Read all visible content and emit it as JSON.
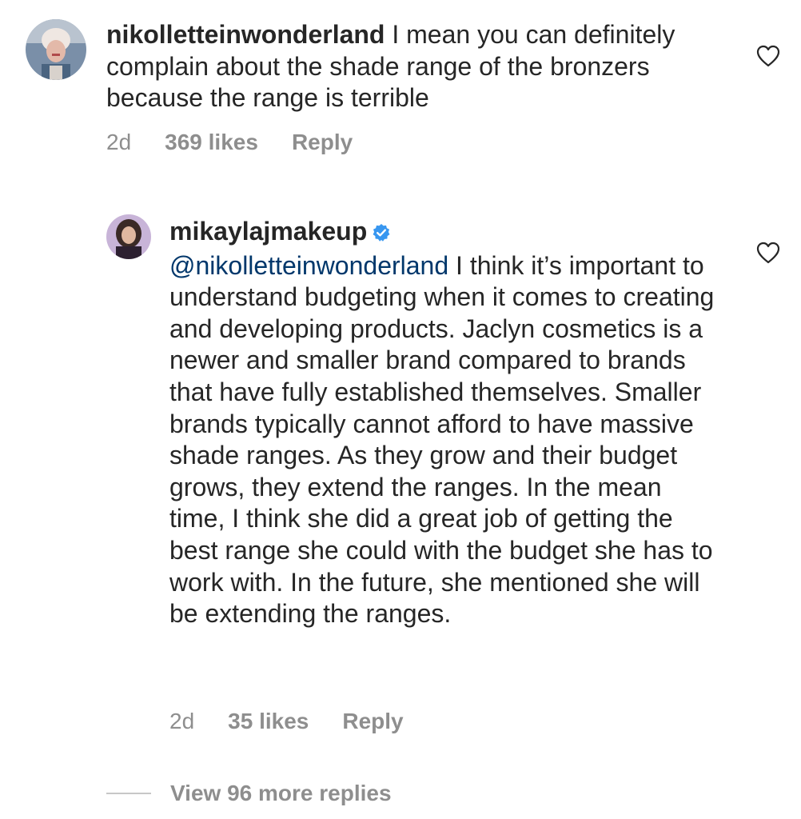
{
  "comments": [
    {
      "username": "nikolletteinwonderland",
      "text": "I mean you can definitely complain about the shade range of the bronzers because the range is terrible",
      "time": "2d",
      "likes": "369 likes",
      "reply_label": "Reply",
      "avatar_icon": "user-avatar"
    },
    {
      "username": "mikaylajmakeup",
      "verified": true,
      "mention": "@nikolletteinwonderland",
      "text": "I think it’s important to understand budgeting when it comes to creating and developing products. Jaclyn cosmetics is a newer and smaller brand compared to brands that have fully established themselves. Smaller brands typically cannot afford to have massive shade ranges. As they grow and their budget grows, they extend the ranges. In the mean time, I think she did a great job of getting the best range she could with the budget she has to work with. In the future, she mentioned she will be extending the ranges.",
      "time": "2d",
      "likes": "35 likes",
      "reply_label": "Reply",
      "avatar_icon": "user-avatar"
    }
  ],
  "view_more_replies": "View 96 more replies",
  "colors": {
    "text": "#262626",
    "muted": "#8e8e8e",
    "mention": "#00376b",
    "verified": "#3897f0"
  },
  "icons": {
    "like": "heart-outline-icon",
    "verified": "verified-badge-icon"
  }
}
